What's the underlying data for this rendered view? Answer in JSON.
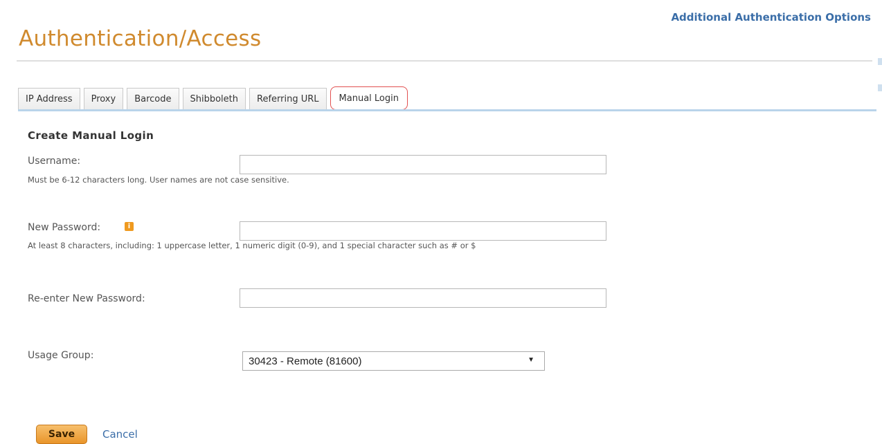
{
  "header": {
    "link_text": "Additional Authentication Options",
    "title": "Authentication/Access"
  },
  "tabs": [
    {
      "label": "IP Address"
    },
    {
      "label": "Proxy"
    },
    {
      "label": "Barcode"
    },
    {
      "label": "Shibboleth"
    },
    {
      "label": "Referring URL"
    },
    {
      "label": "Manual Login",
      "active": true
    }
  ],
  "form": {
    "section_title": "Create Manual Login",
    "username": {
      "label": "Username:",
      "value": "",
      "hint": "Must be 6-12 characters long. User names are not case sensitive."
    },
    "new_password": {
      "label": "New Password:",
      "value": "",
      "hint": "At least 8 characters, including: 1 uppercase letter, 1 numeric digit (0-9), and 1 special character such as # or $"
    },
    "reenter_password": {
      "label": "Re-enter New Password:",
      "value": ""
    },
    "usage_group": {
      "label": "Usage Group:",
      "selected": "30423 - Remote (81600)"
    },
    "save_label": "Save",
    "cancel_label": "Cancel"
  },
  "colors": {
    "title": "#d08a2e",
    "link": "#3b6ea8",
    "save_button": "#f0a848",
    "active_tab_outline": "#e25050",
    "info_icon": "#ef9a20"
  },
  "icons": {
    "info": "info-icon",
    "dropdown": "chevron-down-icon"
  }
}
